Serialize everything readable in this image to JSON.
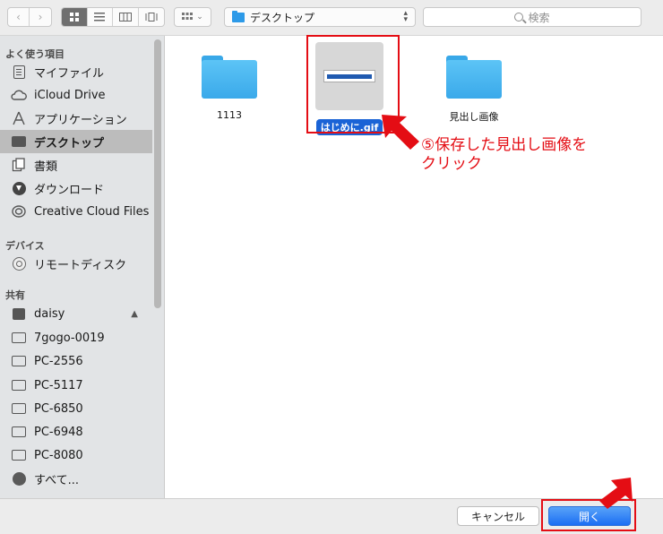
{
  "toolbar": {
    "path_label": "デスクトップ",
    "search_placeholder": "検索"
  },
  "sidebar": {
    "favorites_header": "よく使う項目",
    "favorites": [
      {
        "label": "マイファイル",
        "icon": "documents-icon"
      },
      {
        "label": "iCloud Drive",
        "icon": "cloud-icon"
      },
      {
        "label": "アプリケーション",
        "icon": "applications-icon"
      },
      {
        "label": "デスクトップ",
        "icon": "desktop-icon",
        "selected": true
      },
      {
        "label": "書類",
        "icon": "documents-folder-icon"
      },
      {
        "label": "ダウンロード",
        "icon": "downloads-icon"
      },
      {
        "label": "Creative Cloud Files",
        "icon": "creative-cloud-icon"
      }
    ],
    "devices_header": "デバイス",
    "devices": [
      {
        "label": "リモートディスク",
        "icon": "disc-icon"
      }
    ],
    "shared_header": "共有",
    "shared": [
      {
        "label": "daisy",
        "icon": "computer-icon"
      },
      {
        "label": "7gogo-0019",
        "icon": "display-icon"
      },
      {
        "label": "PC-2556",
        "icon": "display-icon"
      },
      {
        "label": "PC-5117",
        "icon": "display-icon"
      },
      {
        "label": "PC-6850",
        "icon": "display-icon"
      },
      {
        "label": "PC-6948",
        "icon": "display-icon"
      },
      {
        "label": "PC-8080",
        "icon": "display-icon"
      },
      {
        "label": "すべて...",
        "icon": "globe-icon"
      }
    ]
  },
  "files": [
    {
      "name": "1113",
      "kind": "folder"
    },
    {
      "name": "はじめに.gif",
      "kind": "image",
      "selected": true
    },
    {
      "name": "見出し画像",
      "kind": "folder"
    }
  ],
  "annotation": {
    "line1": "⑤保存した見出し画像を",
    "line2": "クリック"
  },
  "buttons": {
    "cancel": "キャンセル",
    "open": "開く"
  },
  "colors": {
    "accent": "#1a63d6",
    "annotation_red": "#e40d14",
    "folder_blue": "#3aa9ea"
  }
}
